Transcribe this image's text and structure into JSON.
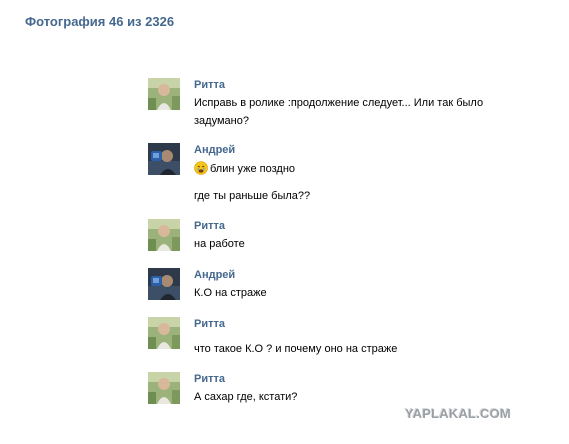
{
  "header": {
    "photo_counter": "Фотография 46 из 2326"
  },
  "messages": [
    {
      "author": "Ритта",
      "avatar": "ritta-avatar",
      "lines": [
        "Исправь в ролике :продолжение следует... Или так было",
        "задумано?"
      ]
    },
    {
      "author": "Андрей",
      "avatar": "andrey-avatar",
      "lines": [
        "блин уже поздно",
        "где ты раньше была??"
      ],
      "emoji": "sad-crying-face-emoji"
    },
    {
      "author": "Ритта",
      "avatar": "ritta-avatar",
      "lines": [
        "на работе"
      ]
    },
    {
      "author": "Андрей",
      "avatar": "andrey-avatar",
      "lines": [
        "К.О на страже"
      ]
    },
    {
      "author": "Ритта",
      "avatar": "ritta-avatar",
      "lines": [
        "что такое К.О ? и почему оно на страже"
      ]
    },
    {
      "author": "Ритта",
      "avatar": "ritta-avatar",
      "lines": [
        "А сахар где, кстати?"
      ]
    }
  ],
  "watermark": "YAPLAKAL.COM",
  "colors": {
    "link": "#45688e",
    "text": "#000000",
    "watermark": "#9aa0a6"
  }
}
